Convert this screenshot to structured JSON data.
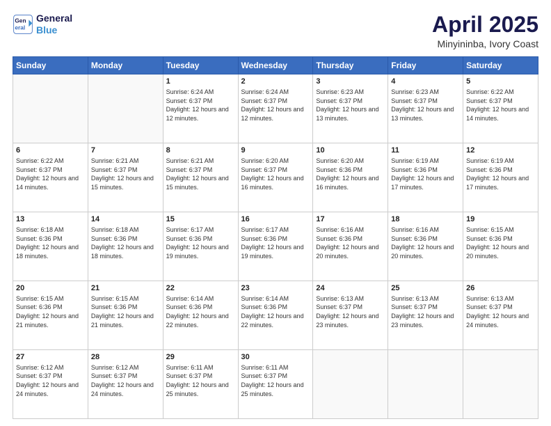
{
  "header": {
    "logo_line1": "General",
    "logo_line2": "Blue",
    "title": "April 2025",
    "subtitle": "Minyininba, Ivory Coast"
  },
  "days_of_week": [
    "Sunday",
    "Monday",
    "Tuesday",
    "Wednesday",
    "Thursday",
    "Friday",
    "Saturday"
  ],
  "weeks": [
    [
      {
        "num": "",
        "sunrise": "",
        "sunset": "",
        "daylight": ""
      },
      {
        "num": "",
        "sunrise": "",
        "sunset": "",
        "daylight": ""
      },
      {
        "num": "1",
        "sunrise": "Sunrise: 6:24 AM",
        "sunset": "Sunset: 6:37 PM",
        "daylight": "Daylight: 12 hours and 12 minutes."
      },
      {
        "num": "2",
        "sunrise": "Sunrise: 6:24 AM",
        "sunset": "Sunset: 6:37 PM",
        "daylight": "Daylight: 12 hours and 12 minutes."
      },
      {
        "num": "3",
        "sunrise": "Sunrise: 6:23 AM",
        "sunset": "Sunset: 6:37 PM",
        "daylight": "Daylight: 12 hours and 13 minutes."
      },
      {
        "num": "4",
        "sunrise": "Sunrise: 6:23 AM",
        "sunset": "Sunset: 6:37 PM",
        "daylight": "Daylight: 12 hours and 13 minutes."
      },
      {
        "num": "5",
        "sunrise": "Sunrise: 6:22 AM",
        "sunset": "Sunset: 6:37 PM",
        "daylight": "Daylight: 12 hours and 14 minutes."
      }
    ],
    [
      {
        "num": "6",
        "sunrise": "Sunrise: 6:22 AM",
        "sunset": "Sunset: 6:37 PM",
        "daylight": "Daylight: 12 hours and 14 minutes."
      },
      {
        "num": "7",
        "sunrise": "Sunrise: 6:21 AM",
        "sunset": "Sunset: 6:37 PM",
        "daylight": "Daylight: 12 hours and 15 minutes."
      },
      {
        "num": "8",
        "sunrise": "Sunrise: 6:21 AM",
        "sunset": "Sunset: 6:37 PM",
        "daylight": "Daylight: 12 hours and 15 minutes."
      },
      {
        "num": "9",
        "sunrise": "Sunrise: 6:20 AM",
        "sunset": "Sunset: 6:37 PM",
        "daylight": "Daylight: 12 hours and 16 minutes."
      },
      {
        "num": "10",
        "sunrise": "Sunrise: 6:20 AM",
        "sunset": "Sunset: 6:36 PM",
        "daylight": "Daylight: 12 hours and 16 minutes."
      },
      {
        "num": "11",
        "sunrise": "Sunrise: 6:19 AM",
        "sunset": "Sunset: 6:36 PM",
        "daylight": "Daylight: 12 hours and 17 minutes."
      },
      {
        "num": "12",
        "sunrise": "Sunrise: 6:19 AM",
        "sunset": "Sunset: 6:36 PM",
        "daylight": "Daylight: 12 hours and 17 minutes."
      }
    ],
    [
      {
        "num": "13",
        "sunrise": "Sunrise: 6:18 AM",
        "sunset": "Sunset: 6:36 PM",
        "daylight": "Daylight: 12 hours and 18 minutes."
      },
      {
        "num": "14",
        "sunrise": "Sunrise: 6:18 AM",
        "sunset": "Sunset: 6:36 PM",
        "daylight": "Daylight: 12 hours and 18 minutes."
      },
      {
        "num": "15",
        "sunrise": "Sunrise: 6:17 AM",
        "sunset": "Sunset: 6:36 PM",
        "daylight": "Daylight: 12 hours and 19 minutes."
      },
      {
        "num": "16",
        "sunrise": "Sunrise: 6:17 AM",
        "sunset": "Sunset: 6:36 PM",
        "daylight": "Daylight: 12 hours and 19 minutes."
      },
      {
        "num": "17",
        "sunrise": "Sunrise: 6:16 AM",
        "sunset": "Sunset: 6:36 PM",
        "daylight": "Daylight: 12 hours and 20 minutes."
      },
      {
        "num": "18",
        "sunrise": "Sunrise: 6:16 AM",
        "sunset": "Sunset: 6:36 PM",
        "daylight": "Daylight: 12 hours and 20 minutes."
      },
      {
        "num": "19",
        "sunrise": "Sunrise: 6:15 AM",
        "sunset": "Sunset: 6:36 PM",
        "daylight": "Daylight: 12 hours and 20 minutes."
      }
    ],
    [
      {
        "num": "20",
        "sunrise": "Sunrise: 6:15 AM",
        "sunset": "Sunset: 6:36 PM",
        "daylight": "Daylight: 12 hours and 21 minutes."
      },
      {
        "num": "21",
        "sunrise": "Sunrise: 6:15 AM",
        "sunset": "Sunset: 6:36 PM",
        "daylight": "Daylight: 12 hours and 21 minutes."
      },
      {
        "num": "22",
        "sunrise": "Sunrise: 6:14 AM",
        "sunset": "Sunset: 6:36 PM",
        "daylight": "Daylight: 12 hours and 22 minutes."
      },
      {
        "num": "23",
        "sunrise": "Sunrise: 6:14 AM",
        "sunset": "Sunset: 6:36 PM",
        "daylight": "Daylight: 12 hours and 22 minutes."
      },
      {
        "num": "24",
        "sunrise": "Sunrise: 6:13 AM",
        "sunset": "Sunset: 6:37 PM",
        "daylight": "Daylight: 12 hours and 23 minutes."
      },
      {
        "num": "25",
        "sunrise": "Sunrise: 6:13 AM",
        "sunset": "Sunset: 6:37 PM",
        "daylight": "Daylight: 12 hours and 23 minutes."
      },
      {
        "num": "26",
        "sunrise": "Sunrise: 6:13 AM",
        "sunset": "Sunset: 6:37 PM",
        "daylight": "Daylight: 12 hours and 24 minutes."
      }
    ],
    [
      {
        "num": "27",
        "sunrise": "Sunrise: 6:12 AM",
        "sunset": "Sunset: 6:37 PM",
        "daylight": "Daylight: 12 hours and 24 minutes."
      },
      {
        "num": "28",
        "sunrise": "Sunrise: 6:12 AM",
        "sunset": "Sunset: 6:37 PM",
        "daylight": "Daylight: 12 hours and 24 minutes."
      },
      {
        "num": "29",
        "sunrise": "Sunrise: 6:11 AM",
        "sunset": "Sunset: 6:37 PM",
        "daylight": "Daylight: 12 hours and 25 minutes."
      },
      {
        "num": "30",
        "sunrise": "Sunrise: 6:11 AM",
        "sunset": "Sunset: 6:37 PM",
        "daylight": "Daylight: 12 hours and 25 minutes."
      },
      {
        "num": "",
        "sunrise": "",
        "sunset": "",
        "daylight": ""
      },
      {
        "num": "",
        "sunrise": "",
        "sunset": "",
        "daylight": ""
      },
      {
        "num": "",
        "sunrise": "",
        "sunset": "",
        "daylight": ""
      }
    ]
  ]
}
